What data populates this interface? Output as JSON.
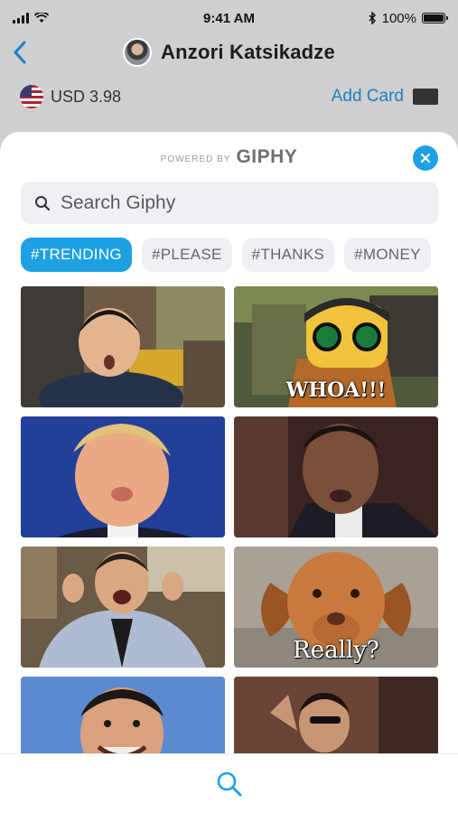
{
  "status_bar": {
    "time": "9:41 AM",
    "battery_label": "100%",
    "battery_level": 1.0
  },
  "nav": {
    "back_icon": "chevron-left-icon",
    "user_name": "Anzori Katsikadze"
  },
  "balance": {
    "flag_icon": "us-flag-icon",
    "text": "USD 3.98",
    "add_card_label": "Add Card"
  },
  "giphy": {
    "powered_by": "POWERED BY",
    "logo": "GIPHY",
    "close_icon": "close-icon",
    "search_placeholder": "Search Giphy",
    "tags": [
      {
        "label": "#TRENDING",
        "active": true
      },
      {
        "label": "#PLEASE",
        "active": false
      },
      {
        "label": "#THANKS",
        "active": false
      },
      {
        "label": "#MONEY",
        "active": false
      }
    ],
    "gifs": [
      {
        "subject": "surprised boy",
        "caption": ""
      },
      {
        "subject": "lego robin with green goggles",
        "caption": "WHOA!!!"
      },
      {
        "subject": "man puckering lips",
        "caption": ""
      },
      {
        "subject": "man in suit talking",
        "caption": ""
      },
      {
        "subject": "man celebrating",
        "caption": ""
      },
      {
        "subject": "puppy skeptical face",
        "caption": "Really?"
      },
      {
        "subject": "man grinning",
        "caption": ""
      },
      {
        "subject": "chef sprinkling salt",
        "caption": ""
      }
    ],
    "tab_search_icon": "search-icon"
  },
  "colors": {
    "accent": "#1da1e2",
    "link": "#1f7fc4",
    "chip_bg": "#eef0f3",
    "backdrop": "#cfcfcf"
  }
}
